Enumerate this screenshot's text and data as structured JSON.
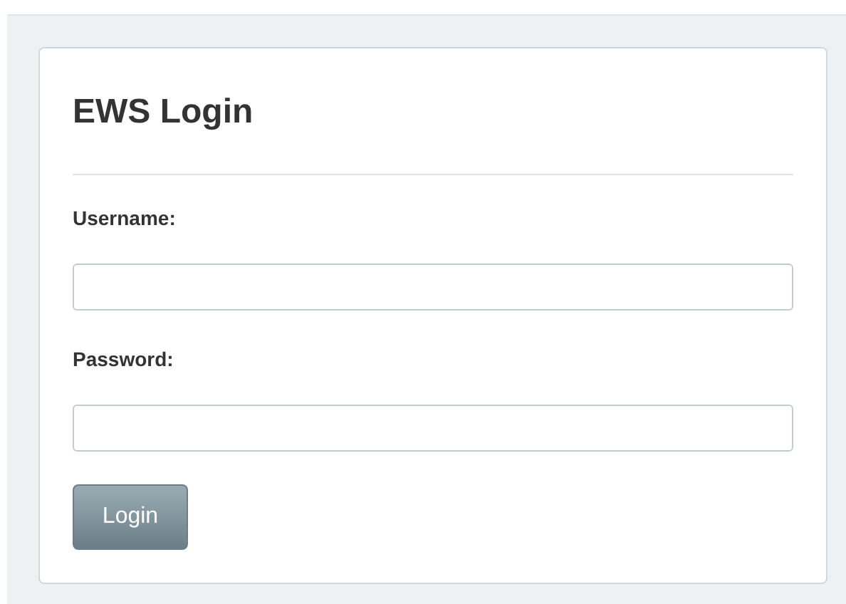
{
  "title": "EWS Login",
  "fields": [
    {
      "label": "Username:"
    },
    {
      "label": "Password:"
    }
  ],
  "button": "Login"
}
